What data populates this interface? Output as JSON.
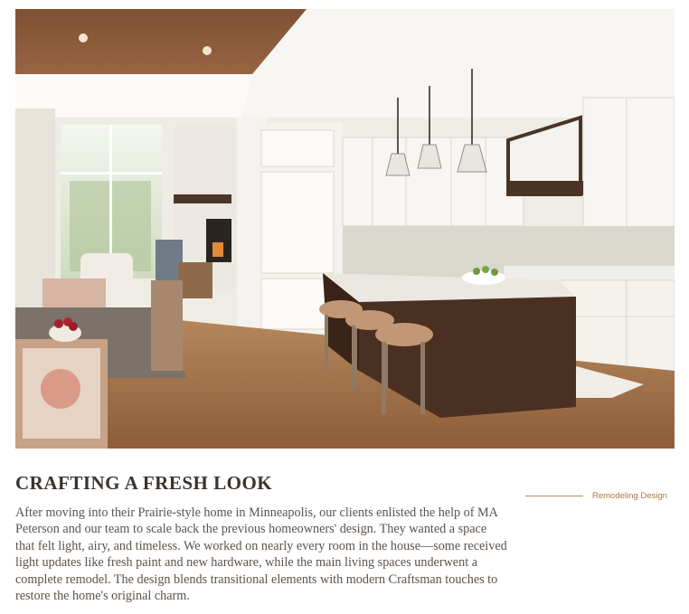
{
  "hero": {
    "image_name": "kitchen-dining-photo"
  },
  "article": {
    "heading": "CRAFTING A FRESH LOOK",
    "body": "After moving into their Prairie-style home in Minneapolis, our clients enlisted the help of MA Peterson and our team to scale back the previous homeowners' design. They wanted a space that felt light, airy, and timeless. We worked on nearly every room in the house—some received light updates like fresh paint and new hardware, while the main living spaces underwent a complete remodel. The design blends transitional elements with modern Craftsman touches to restore the home's original charm."
  },
  "sidebar": {
    "tag_label": "Remodeling Design"
  },
  "colors": {
    "accent": "#b78a55",
    "heading": "#3a3431",
    "body": "#5a534e"
  }
}
